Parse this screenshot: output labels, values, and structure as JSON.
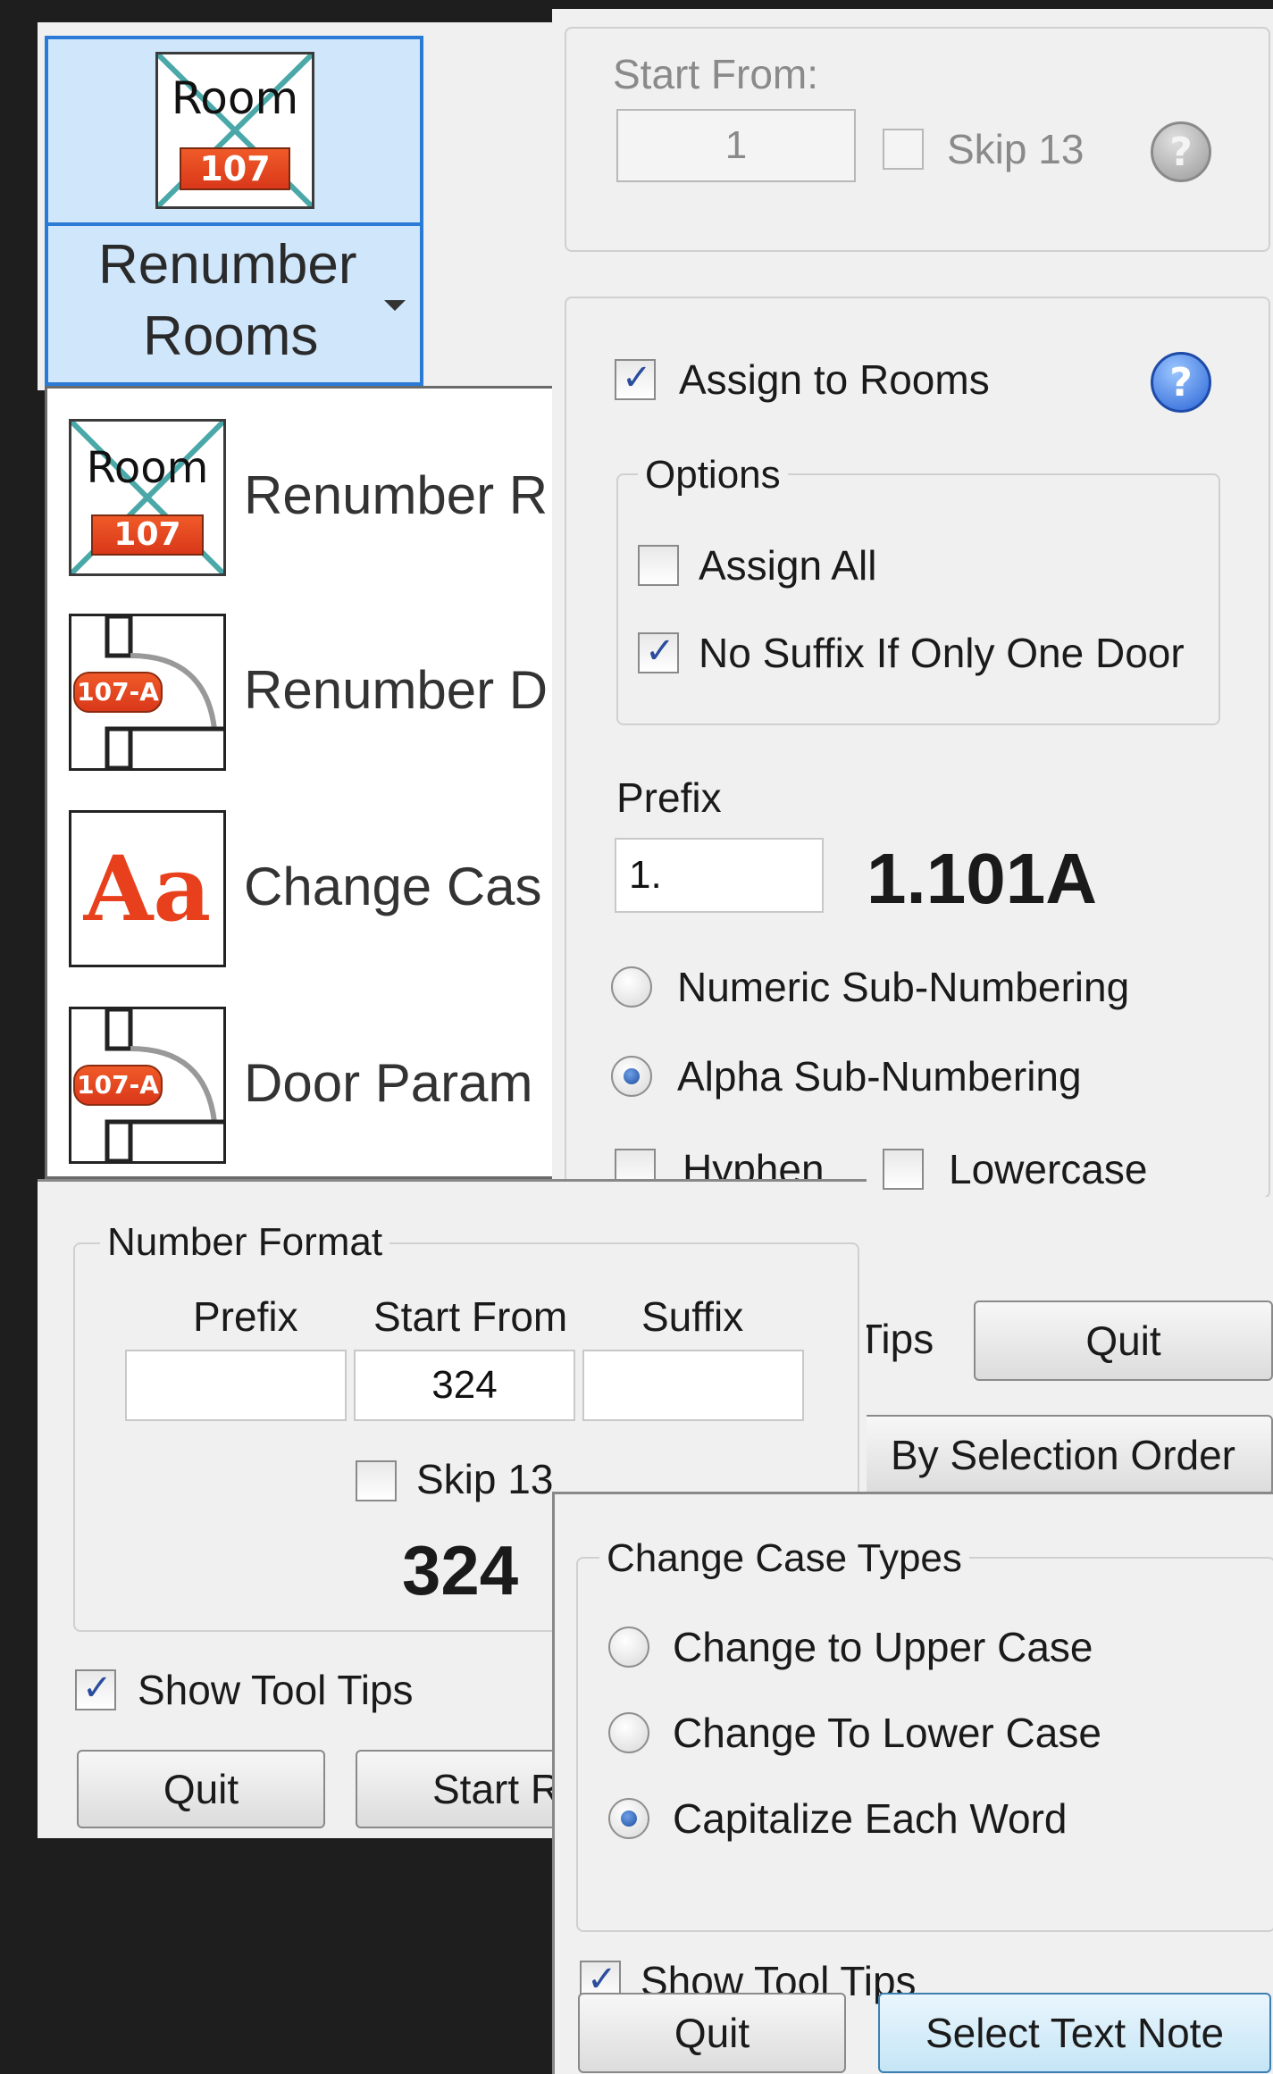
{
  "ribbon": {
    "icon_room_label": "Room",
    "icon_number": "107",
    "button_line1": "Renumber",
    "button_line2": "Rooms"
  },
  "menu": {
    "items": [
      {
        "label": "Renumber R",
        "icon": "room-tag-icon",
        "icon_text": "Room",
        "icon_number": "107"
      },
      {
        "label": "Renumber D",
        "icon": "door-tag-icon",
        "icon_text": "107-A"
      },
      {
        "label": "Change Cas",
        "icon": "change-case-icon",
        "icon_text": "Aa"
      },
      {
        "label": "Door Param",
        "icon": "door-tag-icon",
        "icon_text": "107-A"
      }
    ]
  },
  "door_panel": {
    "start_from_label": "Start From:",
    "start_from_value": "1",
    "skip13_label": "Skip 13",
    "assign_rooms_label": "Assign to Rooms",
    "options_title": "Options",
    "assign_all_label": "Assign All",
    "no_suffix_label": "No Suffix If Only One Door",
    "prefix_label": "Prefix",
    "prefix_value": "1.",
    "preview": "1.101A",
    "numeric_label": "Numeric Sub-Numbering",
    "alpha_label": "Alpha Sub-Numbering",
    "hyphen_label": "Hyphen",
    "lowercase_label": "Lowercase",
    "tips_partial": "Tips",
    "quit_label": "Quit",
    "selection_order_label": "By Selection Order"
  },
  "room_panel": {
    "number_format_title": "Number Format",
    "prefix_header": "Prefix",
    "start_header": "Start From",
    "suffix_header": "Suffix",
    "prefix_value": "",
    "start_value": "324",
    "suffix_value": "",
    "skip13_label": "Skip 13",
    "preview": "324",
    "show_tips_label": "Show Tool Tips",
    "quit_label": "Quit",
    "start_label": "Start R"
  },
  "case_panel": {
    "group_title": "Change Case Types",
    "upper_label": "Change to Upper Case",
    "lower_label": "Change To Lower Case",
    "capitalize_label": "Capitalize Each Word",
    "show_tips_label": "Show Tool Tips",
    "quit_label": "Quit",
    "select_label": "Select Text Note"
  },
  "colors": {
    "ribbon_highlight": "#cfe6fb",
    "ribbon_border": "#2b7bd6",
    "tag_orange": "#e9482a",
    "accent_blue": "#2a64d6"
  }
}
